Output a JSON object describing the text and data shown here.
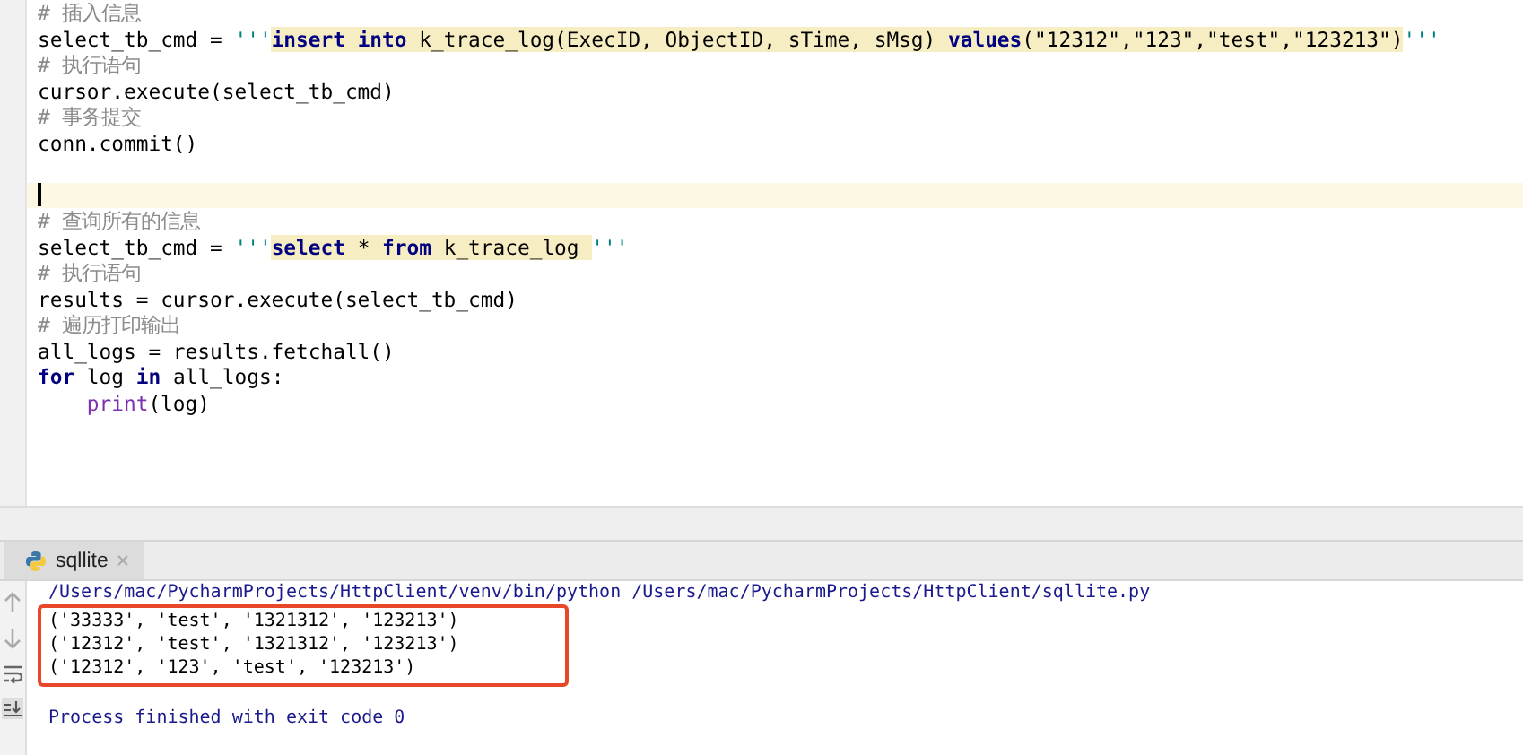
{
  "editor": {
    "lines": [
      {
        "kind": "comment",
        "tokens": [
          {
            "text": "# 插入信息",
            "kind": "comment"
          }
        ]
      },
      {
        "kind": "code",
        "tokens": [
          {
            "text": "select_tb_cmd = ",
            "kind": "plain"
          },
          {
            "text": "'''",
            "kind": "quote"
          },
          {
            "text": "insert into",
            "kind": "sql-keyword"
          },
          {
            "text": " k_trace_log(ExecID, ObjectID, sTime, sMsg) ",
            "kind": "sql"
          },
          {
            "text": "values",
            "kind": "sql-keyword"
          },
          {
            "text": "(\"12312\",\"123\",\"test\",\"123213\")",
            "kind": "sql"
          },
          {
            "text": "'''",
            "kind": "quote"
          }
        ]
      },
      {
        "kind": "comment",
        "tokens": [
          {
            "text": "# 执行语句",
            "kind": "comment"
          }
        ]
      },
      {
        "kind": "code",
        "tokens": [
          {
            "text": "cursor.execute(select_tb_cmd)",
            "kind": "plain"
          }
        ]
      },
      {
        "kind": "comment",
        "tokens": [
          {
            "text": "# 事务提交",
            "kind": "comment"
          }
        ]
      },
      {
        "kind": "code",
        "tokens": [
          {
            "text": "conn.commit()",
            "kind": "plain"
          }
        ]
      },
      {
        "kind": "blank"
      },
      {
        "kind": "caret"
      },
      {
        "kind": "comment",
        "tokens": [
          {
            "text": "# 查询所有的信息",
            "kind": "comment"
          }
        ]
      },
      {
        "kind": "code",
        "tokens": [
          {
            "text": "select_tb_cmd = ",
            "kind": "plain"
          },
          {
            "text": "'''",
            "kind": "quote"
          },
          {
            "text": "select",
            "kind": "sql-keyword"
          },
          {
            "text": " * ",
            "kind": "sql"
          },
          {
            "text": "from",
            "kind": "sql-keyword"
          },
          {
            "text": " k_trace_log ",
            "kind": "sql"
          },
          {
            "text": "'''",
            "kind": "quote"
          }
        ]
      },
      {
        "kind": "comment",
        "tokens": [
          {
            "text": "# 执行语句",
            "kind": "comment"
          }
        ]
      },
      {
        "kind": "code",
        "tokens": [
          {
            "text": "results = cursor.execute(select_tb_cmd)",
            "kind": "plain"
          }
        ]
      },
      {
        "kind": "comment",
        "tokens": [
          {
            "text": "# 遍历打印输出",
            "kind": "comment"
          }
        ]
      },
      {
        "kind": "code",
        "tokens": [
          {
            "text": "all_logs = results.fetchall()",
            "kind": "plain"
          }
        ]
      },
      {
        "kind": "code",
        "tokens": [
          {
            "text": "for",
            "kind": "keyword"
          },
          {
            "text": " log ",
            "kind": "plain"
          },
          {
            "text": "in",
            "kind": "keyword"
          },
          {
            "text": " all_logs:",
            "kind": "plain"
          }
        ]
      },
      {
        "kind": "indented-code",
        "tokens": [
          {
            "text": "print",
            "kind": "builtin"
          },
          {
            "text": "(log)",
            "kind": "plain"
          }
        ]
      }
    ]
  },
  "run_panel": {
    "tabs": [
      {
        "label": "sqllite",
        "selected": true
      }
    ],
    "command": "/Users/mac/PycharmProjects/HttpClient/venv/bin/python /Users/mac/PycharmProjects/HttpClient/sqllite.py",
    "output": [
      "('33333', 'test', '1321312', '123213')",
      "('12312', 'test', '1321312', '123213')",
      "('12312', '123', 'test', '123213')"
    ],
    "exit_message": "Process finished with exit code 0"
  }
}
